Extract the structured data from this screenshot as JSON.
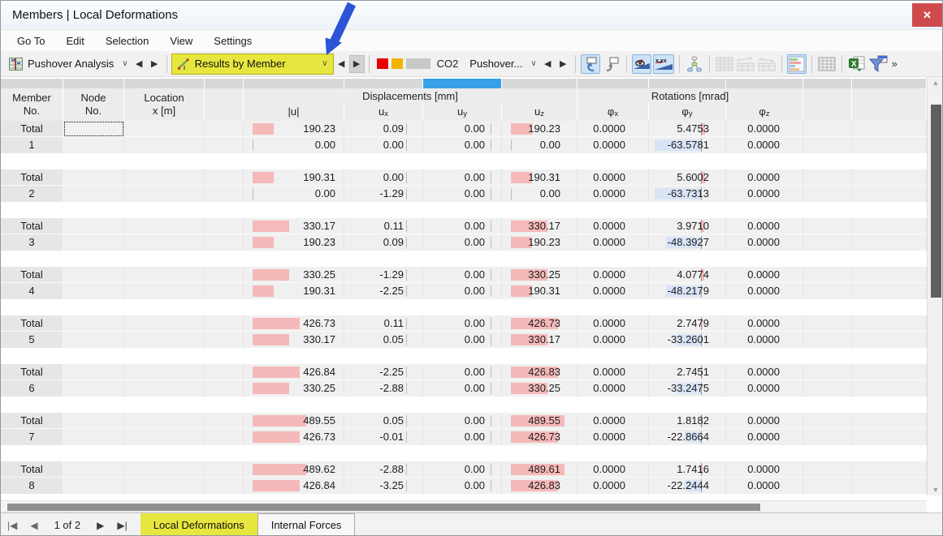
{
  "window": {
    "title": "Members | Local Deformations",
    "close_glyph": "✕"
  },
  "menu": [
    "Go To",
    "Edit",
    "Selection",
    "View",
    "Settings"
  ],
  "toolbar": {
    "analysis": {
      "value": "Pushover Analysis"
    },
    "results": {
      "value": "Results by Member"
    },
    "legend_label": "CO2",
    "combination": {
      "value": "Pushover..."
    },
    "overflow": "»",
    "accent_yellow": "#e7e63e",
    "arrow_blue": "#2d53d6",
    "swatch_red": "#e80000",
    "swatch_yellow": "#f0b400",
    "swatch_gray": "#c8c8c8"
  },
  "table": {
    "headers": {
      "member": [
        "Member",
        "No."
      ],
      "node": [
        "Node",
        "No."
      ],
      "location": [
        "Location",
        "x [m]"
      ],
      "displacements_group": "Displacements [mm]",
      "rotations_group": "Rotations [mrad]",
      "sub": [
        {
          "base": "|u|",
          "sub": ""
        },
        {
          "base": "u",
          "sub": "x"
        },
        {
          "base": "u",
          "sub": "y"
        },
        {
          "base": "u",
          "sub": "z"
        },
        {
          "base": "φ",
          "sub": "x"
        },
        {
          "base": "φ",
          "sub": "y"
        },
        {
          "base": "φ",
          "sub": "z"
        }
      ]
    },
    "total_label": "Total",
    "bar_positive_color": "#f6b9b9",
    "bar_negative_color": "#d9e4f7",
    "strip_highlight_color": "#36a0e9",
    "groups": [
      {
        "member": "1",
        "rows": [
          [
            "190.23",
            "0.09",
            "0.00",
            "190.23",
            "0.0000",
            "5.4753",
            "0.0000"
          ],
          [
            "0.00",
            "0.00",
            "0.00",
            "0.00",
            "0.0000",
            "-63.5781",
            "0.0000"
          ]
        ]
      },
      {
        "member": "2",
        "rows": [
          [
            "190.31",
            "0.00",
            "0.00",
            "190.31",
            "0.0000",
            "5.6002",
            "0.0000"
          ],
          [
            "0.00",
            "-1.29",
            "0.00",
            "0.00",
            "0.0000",
            "-63.7313",
            "0.0000"
          ]
        ]
      },
      {
        "member": "3",
        "rows": [
          [
            "330.17",
            "0.11",
            "0.00",
            "330.17",
            "0.0000",
            "3.9710",
            "0.0000"
          ],
          [
            "190.23",
            "0.09",
            "0.00",
            "190.23",
            "0.0000",
            "-48.3927",
            "0.0000"
          ]
        ]
      },
      {
        "member": "4",
        "rows": [
          [
            "330.25",
            "-1.29",
            "0.00",
            "330.25",
            "0.0000",
            "4.0774",
            "0.0000"
          ],
          [
            "190.31",
            "-2.25",
            "0.00",
            "190.31",
            "0.0000",
            "-48.2179",
            "0.0000"
          ]
        ]
      },
      {
        "member": "5",
        "rows": [
          [
            "426.73",
            "0.11",
            "0.00",
            "426.73",
            "0.0000",
            "2.7479",
            "0.0000"
          ],
          [
            "330.17",
            "0.05",
            "0.00",
            "330.17",
            "0.0000",
            "-33.2601",
            "0.0000"
          ]
        ]
      },
      {
        "member": "6",
        "rows": [
          [
            "426.84",
            "-2.25",
            "0.00",
            "426.83",
            "0.0000",
            "2.7451",
            "0.0000"
          ],
          [
            "330.25",
            "-2.88",
            "0.00",
            "330.25",
            "0.0000",
            "-33.2475",
            "0.0000"
          ]
        ]
      },
      {
        "member": "7",
        "rows": [
          [
            "489.55",
            "0.05",
            "0.00",
            "489.55",
            "0.0000",
            "1.8182",
            "0.0000"
          ],
          [
            "426.73",
            "-0.01",
            "0.00",
            "426.73",
            "0.0000",
            "-22.8664",
            "0.0000"
          ]
        ]
      },
      {
        "member": "8",
        "rows": [
          [
            "489.62",
            "-2.88",
            "0.00",
            "489.61",
            "0.0000",
            "1.7416",
            "0.0000"
          ],
          [
            "426.84",
            "-3.25",
            "0.00",
            "426.83",
            "0.0000",
            "-22.2444",
            "0.0000"
          ]
        ]
      }
    ]
  },
  "footer": {
    "pager": "1 of 2",
    "tabs": [
      {
        "label": "Local Deformations",
        "active": true
      },
      {
        "label": "Internal Forces",
        "active": false
      }
    ]
  }
}
